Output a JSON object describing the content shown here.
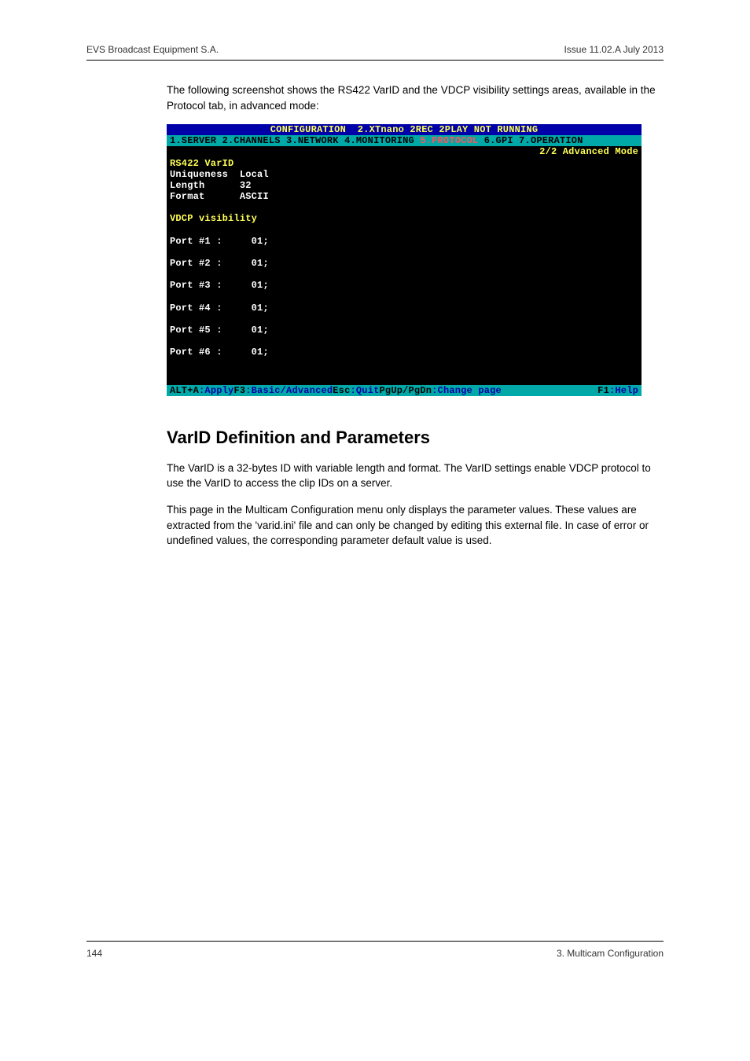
{
  "header": {
    "left": "EVS Broadcast Equipment S.A.",
    "right": "Issue 11.02.A   July 2013"
  },
  "intro": "The following screenshot shows the RS422 VarID and the VDCP visibility settings areas, available in the Protocol tab, in advanced mode:",
  "terminal": {
    "title": "CONFIGURATION  2.XTnano 2REC 2PLAY NOT RUNNING",
    "menu": {
      "m1": "1.SERVER",
      "m2": "2.CHANNELS",
      "m3": "3.NETWORK",
      "m4": "4.MONITORING",
      "m5": "5.PROTOCOL",
      "m6": "6.GPI",
      "m7": "7.OPERATION"
    },
    "mode": "2/2 Advanced Mode",
    "varid_header": "RS422 VarID",
    "varid": {
      "uniq_label": "Uniqueness",
      "uniq_value": "Local",
      "len_label": "Length",
      "len_value": "32",
      "fmt_label": "Format",
      "fmt_value": "ASCII"
    },
    "vdcp_header": "VDCP visibility",
    "ports": [
      {
        "label": "Port #1 :",
        "value": "01;"
      },
      {
        "label": "Port #2 :",
        "value": "01;"
      },
      {
        "label": "Port #3 :",
        "value": "01;"
      },
      {
        "label": "Port #4 :",
        "value": "01;"
      },
      {
        "label": "Port #5 :",
        "value": "01;"
      },
      {
        "label": "Port #6 :",
        "value": "01;"
      }
    ],
    "status": {
      "k1": "ALT+A",
      "d1": ":Apply",
      "k2": "F3",
      "d2": ":Basic/Advanced",
      "k3": "Esc",
      "d3": ":Quit",
      "k4": "PgUp/PgDn",
      "d4": ":Change page",
      "k5": "F1",
      "d5": ":Help"
    }
  },
  "section_title": "VarID Definition and Parameters",
  "para1": "The VarID is a 32-bytes ID with variable length and format. The VarID settings enable VDCP protocol to use the VarID to access the clip IDs on a server.",
  "para2": "This page in the Multicam Configuration menu only displays the parameter values. These values are extracted from the 'varid.ini' file and can only be changed by editing this external file. In case of error or undefined values, the corresponding parameter default value is used.",
  "footer": {
    "left": "144",
    "right": "3. Multicam Configuration"
  }
}
